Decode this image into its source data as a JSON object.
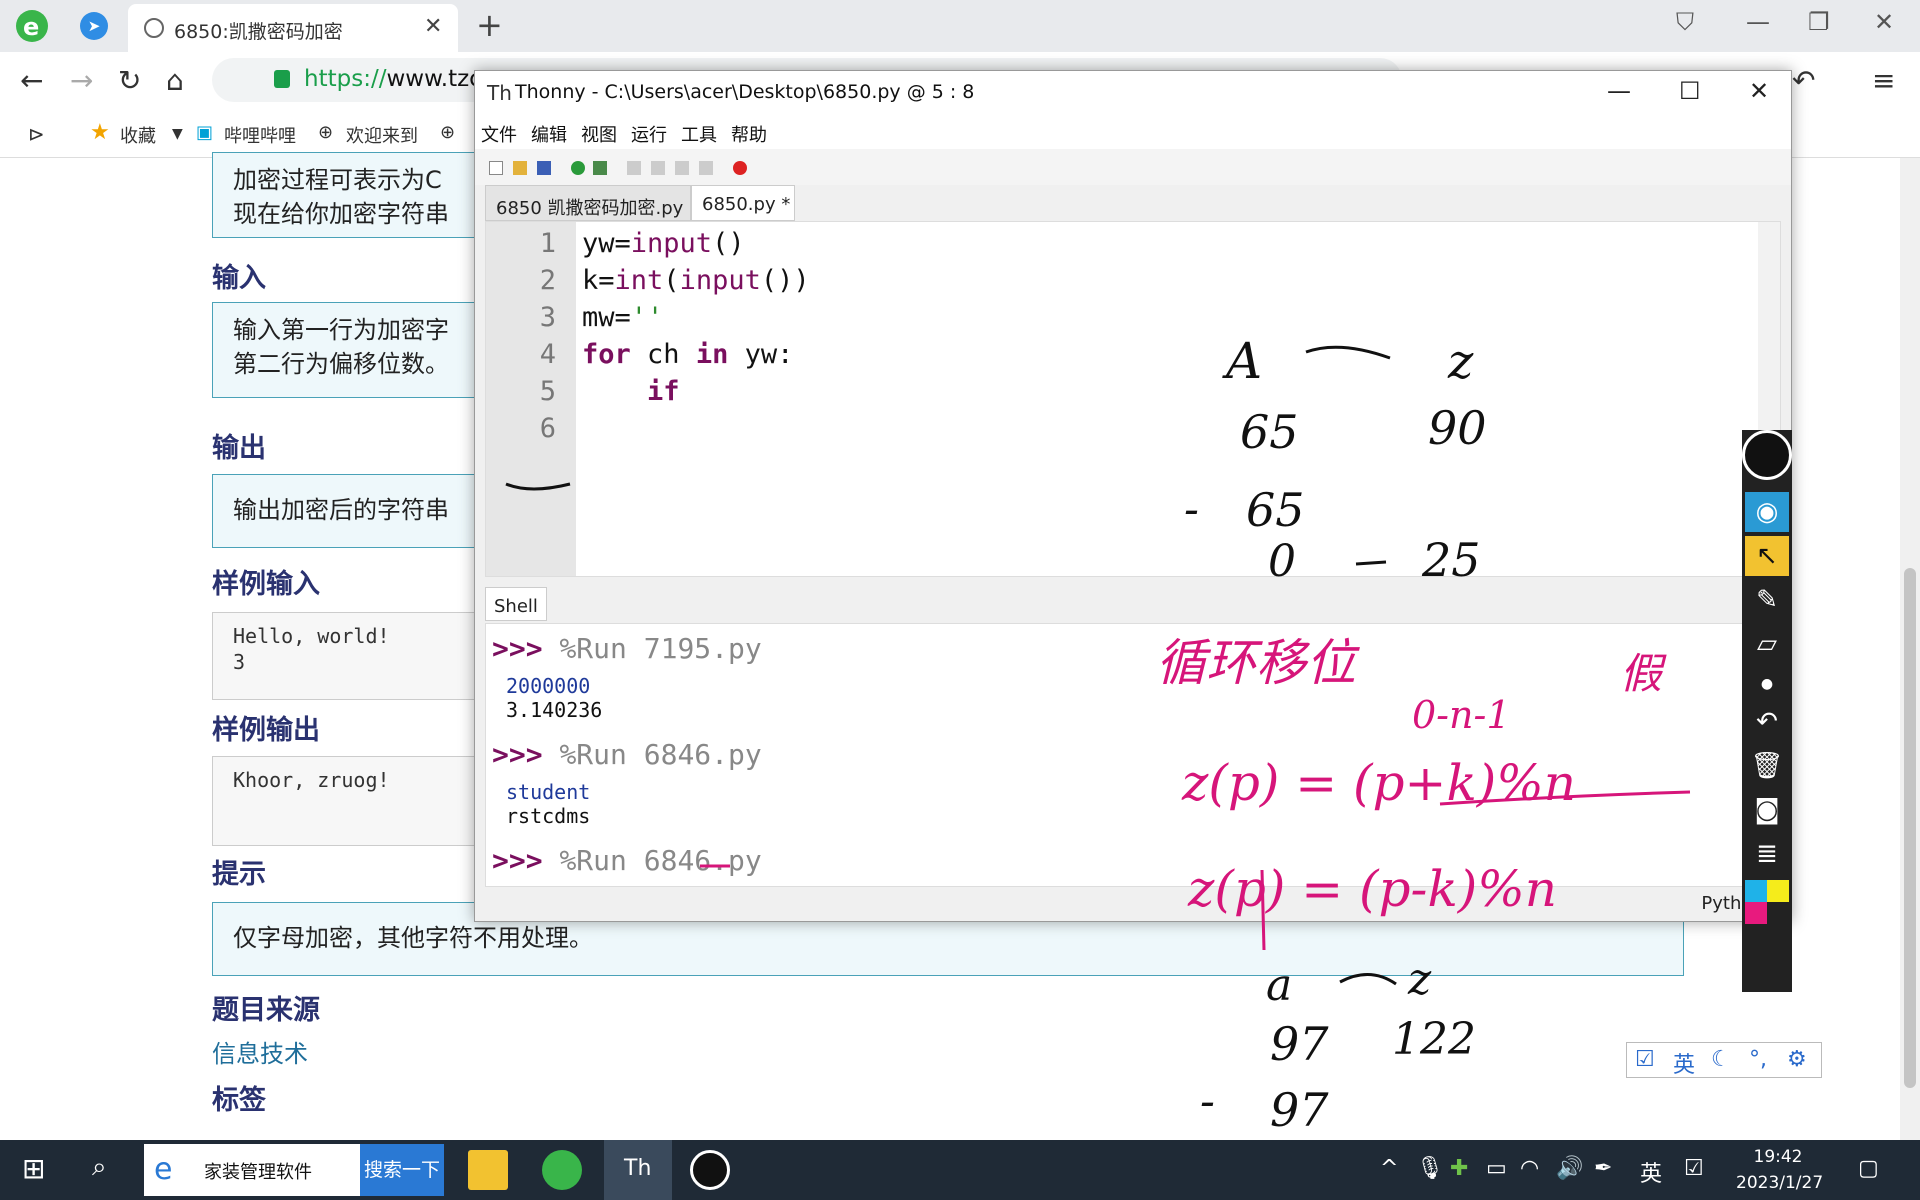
{
  "browser": {
    "tab_title": "6850:凯撒密码加密",
    "url_scheme": "https://",
    "url_rest": "www.tzco",
    "bookmarks": [
      "收藏",
      "哔哩哔哩",
      "欢迎来到"
    ]
  },
  "page": {
    "intro_line1": "加密过程可表示为C",
    "intro_line2": "现在给你加密字符串",
    "input_heading": "输入",
    "input_text1": "输入第一行为加密字",
    "input_text2": "第二行为偏移位数。",
    "output_heading": "输出",
    "output_text": "输出加密后的字符串",
    "sample_in_heading": "样例输入",
    "sample_in_line1": "Hello, world!",
    "sample_in_line2": "3",
    "sample_out_heading": "样例输出",
    "sample_out_text": "Khoor, zruog!",
    "hint_heading": "提示",
    "hint_text": "仅字母加密，其他字符不用处理。",
    "source_heading": "题目来源",
    "source_link": "信息技术",
    "tags_heading": "标签"
  },
  "thonny": {
    "title": "Thonny  -  C:\\Users\\acer\\Desktop\\6850.py  @  5 : 8",
    "menu": [
      "文件",
      "编辑",
      "视图",
      "运行",
      "工具",
      "帮助"
    ],
    "tabs": [
      "6850 凯撒密码加密.py",
      "6850.py *"
    ],
    "line_numbers": [
      "1",
      "2",
      "3",
      "4",
      "5",
      "6"
    ],
    "shell_tab": "Shell",
    "prompt": ">>>",
    "run1": "%Run 7195.py",
    "out1a": "2000000",
    "out1b": "3.140236",
    "run2": "%Run 6846.py",
    "out2a": "student",
    "out2b": "rstcdms",
    "run3": "%Run 6846.py",
    "status": "Python 3"
  },
  "ime": {
    "lang": "英"
  },
  "taskbar": {
    "search_text": "家装管理软件",
    "search_button": "搜索一下",
    "ime_lang": "英",
    "time": "19:42",
    "date": "2023/1/27"
  },
  "ink": {
    "black": [
      "A",
      "z",
      "65",
      "90",
      "-",
      "65",
      "0",
      "25",
      "a",
      "z",
      "97",
      "122",
      "-",
      "97"
    ],
    "magenta": [
      "循环移位",
      "假",
      "0-n-1",
      "z(p) = (p+k)%n",
      "z(p) = (p-k)%n"
    ]
  },
  "colors": {
    "heading": "#2a3270",
    "box_border": "#4aa2b8",
    "keyword": "#7a0f5e",
    "ink_magenta": "#d6157a"
  }
}
